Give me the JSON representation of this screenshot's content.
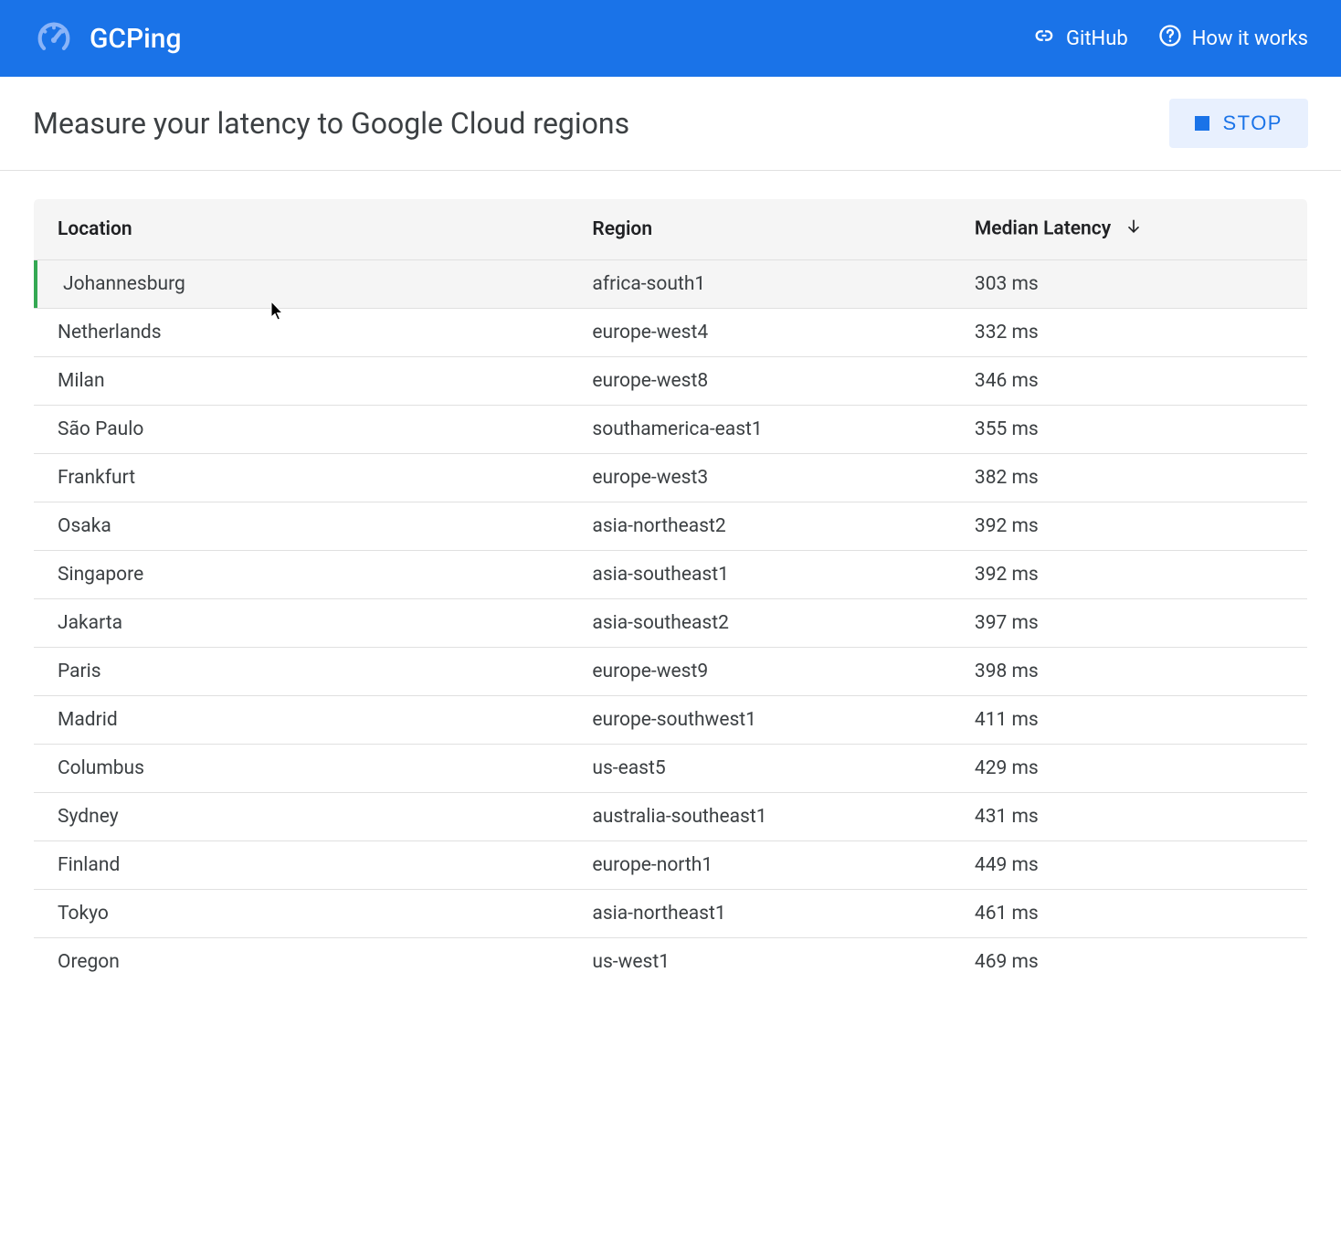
{
  "header": {
    "title": "GCPing",
    "links": {
      "github": "GitHub",
      "how_it_works": "How it works"
    }
  },
  "subheader": {
    "heading": "Measure your latency to Google Cloud regions",
    "stop_label": "STOP"
  },
  "table": {
    "columns": {
      "location": "Location",
      "region": "Region",
      "latency": "Median Latency"
    },
    "rows": [
      {
        "location": "Johannesburg",
        "region": "africa-south1",
        "latency": "303 ms",
        "highlighted": true
      },
      {
        "location": "Netherlands",
        "region": "europe-west4",
        "latency": "332 ms",
        "highlighted": false
      },
      {
        "location": "Milan",
        "region": "europe-west8",
        "latency": "346 ms",
        "highlighted": false
      },
      {
        "location": "São Paulo",
        "region": "southamerica-east1",
        "latency": "355 ms",
        "highlighted": false
      },
      {
        "location": "Frankfurt",
        "region": "europe-west3",
        "latency": "382 ms",
        "highlighted": false
      },
      {
        "location": "Osaka",
        "region": "asia-northeast2",
        "latency": "392 ms",
        "highlighted": false
      },
      {
        "location": "Singapore",
        "region": "asia-southeast1",
        "latency": "392 ms",
        "highlighted": false
      },
      {
        "location": "Jakarta",
        "region": "asia-southeast2",
        "latency": "397 ms",
        "highlighted": false
      },
      {
        "location": "Paris",
        "region": "europe-west9",
        "latency": "398 ms",
        "highlighted": false
      },
      {
        "location": "Madrid",
        "region": "europe-southwest1",
        "latency": "411 ms",
        "highlighted": false
      },
      {
        "location": "Columbus",
        "region": "us-east5",
        "latency": "429 ms",
        "highlighted": false
      },
      {
        "location": "Sydney",
        "region": "australia-southeast1",
        "latency": "431 ms",
        "highlighted": false
      },
      {
        "location": "Finland",
        "region": "europe-north1",
        "latency": "449 ms",
        "highlighted": false
      },
      {
        "location": "Tokyo",
        "region": "asia-northeast1",
        "latency": "461 ms",
        "highlighted": false
      },
      {
        "location": "Oregon",
        "region": "us-west1",
        "latency": "469 ms",
        "highlighted": false
      }
    ]
  }
}
